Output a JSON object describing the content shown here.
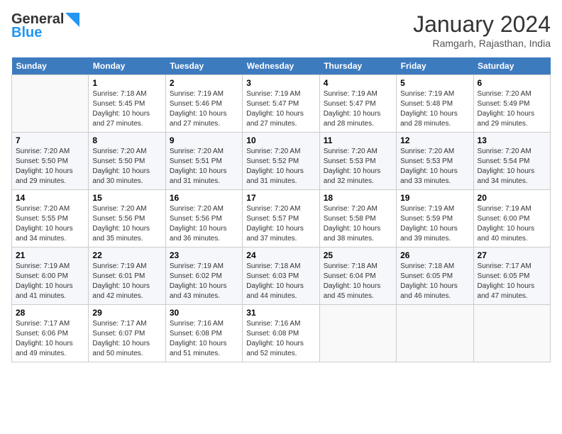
{
  "header": {
    "logo_line1": "General",
    "logo_line2": "Blue",
    "month": "January 2024",
    "location": "Ramgarh, Rajasthan, India"
  },
  "weekdays": [
    "Sunday",
    "Monday",
    "Tuesday",
    "Wednesday",
    "Thursday",
    "Friday",
    "Saturday"
  ],
  "weeks": [
    [
      {
        "day": "",
        "detail": ""
      },
      {
        "day": "1",
        "detail": "Sunrise: 7:18 AM\nSunset: 5:45 PM\nDaylight: 10 hours\nand 27 minutes."
      },
      {
        "day": "2",
        "detail": "Sunrise: 7:19 AM\nSunset: 5:46 PM\nDaylight: 10 hours\nand 27 minutes."
      },
      {
        "day": "3",
        "detail": "Sunrise: 7:19 AM\nSunset: 5:47 PM\nDaylight: 10 hours\nand 27 minutes."
      },
      {
        "day": "4",
        "detail": "Sunrise: 7:19 AM\nSunset: 5:47 PM\nDaylight: 10 hours\nand 28 minutes."
      },
      {
        "day": "5",
        "detail": "Sunrise: 7:19 AM\nSunset: 5:48 PM\nDaylight: 10 hours\nand 28 minutes."
      },
      {
        "day": "6",
        "detail": "Sunrise: 7:20 AM\nSunset: 5:49 PM\nDaylight: 10 hours\nand 29 minutes."
      }
    ],
    [
      {
        "day": "7",
        "detail": "Sunrise: 7:20 AM\nSunset: 5:50 PM\nDaylight: 10 hours\nand 29 minutes."
      },
      {
        "day": "8",
        "detail": "Sunrise: 7:20 AM\nSunset: 5:50 PM\nDaylight: 10 hours\nand 30 minutes."
      },
      {
        "day": "9",
        "detail": "Sunrise: 7:20 AM\nSunset: 5:51 PM\nDaylight: 10 hours\nand 31 minutes."
      },
      {
        "day": "10",
        "detail": "Sunrise: 7:20 AM\nSunset: 5:52 PM\nDaylight: 10 hours\nand 31 minutes."
      },
      {
        "day": "11",
        "detail": "Sunrise: 7:20 AM\nSunset: 5:53 PM\nDaylight: 10 hours\nand 32 minutes."
      },
      {
        "day": "12",
        "detail": "Sunrise: 7:20 AM\nSunset: 5:53 PM\nDaylight: 10 hours\nand 33 minutes."
      },
      {
        "day": "13",
        "detail": "Sunrise: 7:20 AM\nSunset: 5:54 PM\nDaylight: 10 hours\nand 34 minutes."
      }
    ],
    [
      {
        "day": "14",
        "detail": "Sunrise: 7:20 AM\nSunset: 5:55 PM\nDaylight: 10 hours\nand 34 minutes."
      },
      {
        "day": "15",
        "detail": "Sunrise: 7:20 AM\nSunset: 5:56 PM\nDaylight: 10 hours\nand 35 minutes."
      },
      {
        "day": "16",
        "detail": "Sunrise: 7:20 AM\nSunset: 5:56 PM\nDaylight: 10 hours\nand 36 minutes."
      },
      {
        "day": "17",
        "detail": "Sunrise: 7:20 AM\nSunset: 5:57 PM\nDaylight: 10 hours\nand 37 minutes."
      },
      {
        "day": "18",
        "detail": "Sunrise: 7:20 AM\nSunset: 5:58 PM\nDaylight: 10 hours\nand 38 minutes."
      },
      {
        "day": "19",
        "detail": "Sunrise: 7:19 AM\nSunset: 5:59 PM\nDaylight: 10 hours\nand 39 minutes."
      },
      {
        "day": "20",
        "detail": "Sunrise: 7:19 AM\nSunset: 6:00 PM\nDaylight: 10 hours\nand 40 minutes."
      }
    ],
    [
      {
        "day": "21",
        "detail": "Sunrise: 7:19 AM\nSunset: 6:00 PM\nDaylight: 10 hours\nand 41 minutes."
      },
      {
        "day": "22",
        "detail": "Sunrise: 7:19 AM\nSunset: 6:01 PM\nDaylight: 10 hours\nand 42 minutes."
      },
      {
        "day": "23",
        "detail": "Sunrise: 7:19 AM\nSunset: 6:02 PM\nDaylight: 10 hours\nand 43 minutes."
      },
      {
        "day": "24",
        "detail": "Sunrise: 7:18 AM\nSunset: 6:03 PM\nDaylight: 10 hours\nand 44 minutes."
      },
      {
        "day": "25",
        "detail": "Sunrise: 7:18 AM\nSunset: 6:04 PM\nDaylight: 10 hours\nand 45 minutes."
      },
      {
        "day": "26",
        "detail": "Sunrise: 7:18 AM\nSunset: 6:05 PM\nDaylight: 10 hours\nand 46 minutes."
      },
      {
        "day": "27",
        "detail": "Sunrise: 7:17 AM\nSunset: 6:05 PM\nDaylight: 10 hours\nand 47 minutes."
      }
    ],
    [
      {
        "day": "28",
        "detail": "Sunrise: 7:17 AM\nSunset: 6:06 PM\nDaylight: 10 hours\nand 49 minutes."
      },
      {
        "day": "29",
        "detail": "Sunrise: 7:17 AM\nSunset: 6:07 PM\nDaylight: 10 hours\nand 50 minutes."
      },
      {
        "day": "30",
        "detail": "Sunrise: 7:16 AM\nSunset: 6:08 PM\nDaylight: 10 hours\nand 51 minutes."
      },
      {
        "day": "31",
        "detail": "Sunrise: 7:16 AM\nSunset: 6:08 PM\nDaylight: 10 hours\nand 52 minutes."
      },
      {
        "day": "",
        "detail": ""
      },
      {
        "day": "",
        "detail": ""
      },
      {
        "day": "",
        "detail": ""
      }
    ]
  ]
}
